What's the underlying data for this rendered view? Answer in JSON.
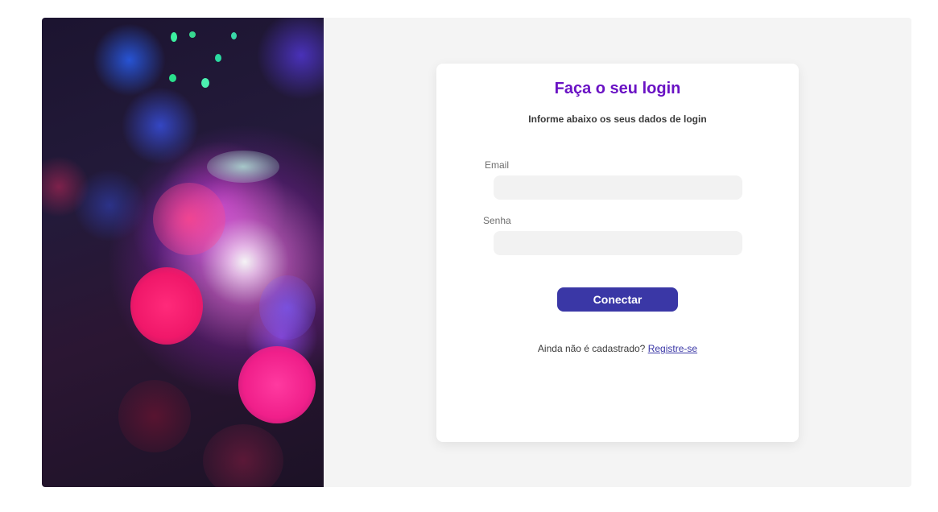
{
  "login": {
    "title": "Faça o seu login",
    "subtitle": "Informe abaixo os seus dados de login",
    "email_label": "Email",
    "email_value": "",
    "password_label": "Senha",
    "password_value": "",
    "submit_label": "Conectar",
    "signup_prompt": "Ainda não é cadastrado?",
    "signup_link": "Registre-se"
  },
  "colors": {
    "title": "#6a12c4",
    "button": "#3a37a6",
    "input_bg": "#f2f2f2",
    "panel_bg": "#f4f4f4"
  }
}
